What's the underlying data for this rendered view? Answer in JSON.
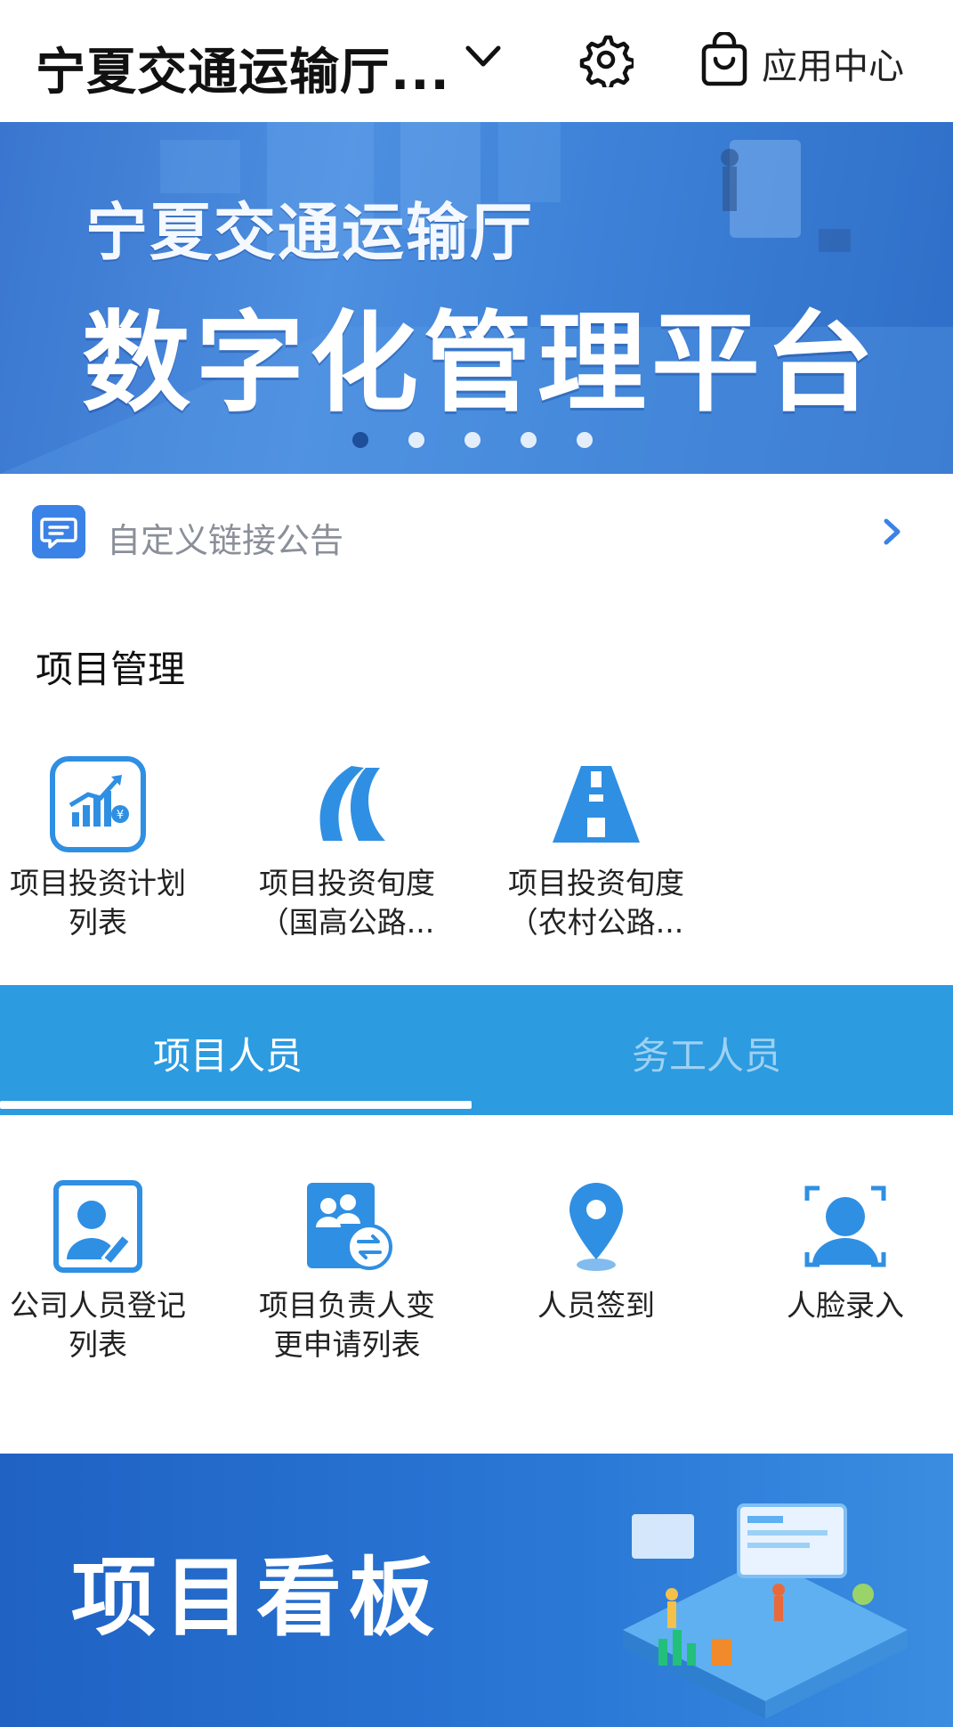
{
  "header": {
    "org_title": "宁夏交通运输厅...",
    "app_center_label": "应用中心",
    "icons": [
      "chevron-down-icon",
      "gear-icon",
      "shopping-bag-icon"
    ]
  },
  "banner": {
    "line1": "宁夏交通运输厅",
    "line2": "数字化管理平台",
    "slide_count": 5,
    "active_slide": 1
  },
  "notice": {
    "text": "自定义链接公告",
    "icon": "message-icon"
  },
  "project_management": {
    "title": "项目管理",
    "items": [
      {
        "line1": "项目投资计划",
        "line2": "列表",
        "icon": "investment-chart-icon"
      },
      {
        "line1": "项目投资旬度",
        "line2": "（国高公路...",
        "icon": "highway-curve-icon"
      },
      {
        "line1": "项目投资旬度",
        "line2": "（农村公路...",
        "icon": "road-icon"
      }
    ]
  },
  "tabs": [
    {
      "label": "项目人员",
      "active": true
    },
    {
      "label": "务工人员",
      "active": false
    }
  ],
  "personnel": {
    "items": [
      {
        "line1": "公司人员登记",
        "line2": "列表",
        "icon": "person-register-icon"
      },
      {
        "line1": "项目负责人变",
        "line2": "更申请列表",
        "icon": "person-swap-icon"
      },
      {
        "line1": "人员签到",
        "line2": "",
        "icon": "location-pin-icon"
      },
      {
        "line1": "人脸录入",
        "line2": "",
        "icon": "face-scan-icon"
      }
    ]
  },
  "dashboard_banner": {
    "title": "项目看板"
  },
  "colors": {
    "primary": "#2c9be0",
    "icon_blue": "#2f8fe3",
    "notice_icon": "#3b82e6",
    "banner_blue": "#3d82d8",
    "tab_inactive": "#9fd1f2"
  }
}
